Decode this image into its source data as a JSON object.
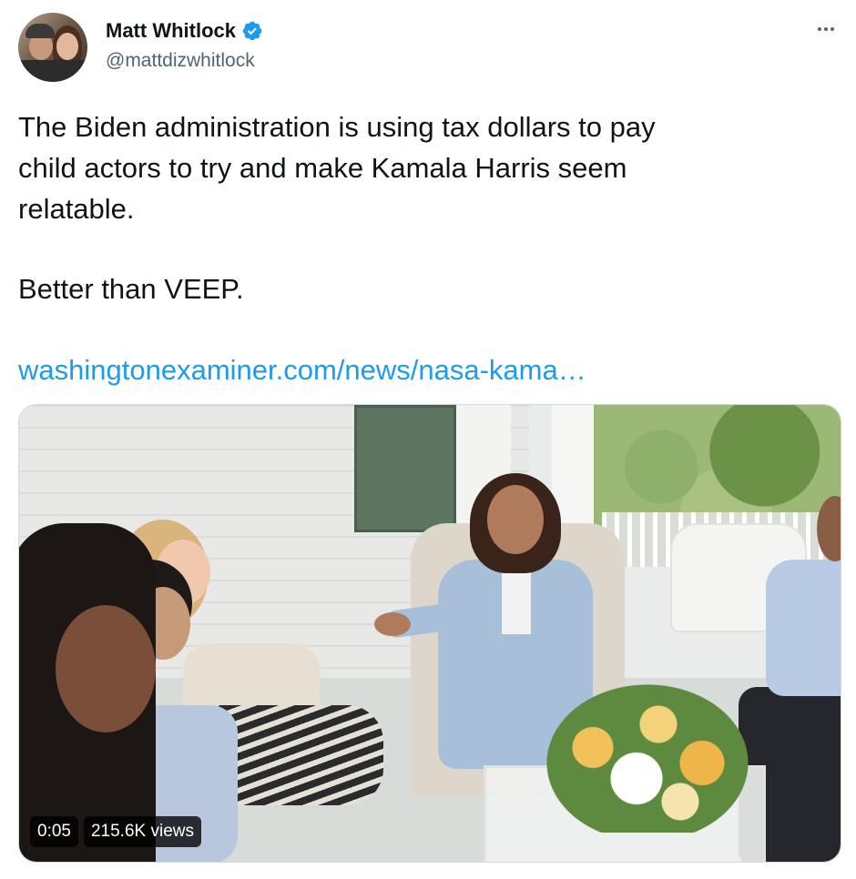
{
  "author": {
    "display_name": "Matt Whitlock",
    "handle": "@mattdizwhitlock",
    "verified": true
  },
  "tweet": {
    "text_lines": [
      "The Biden administration is using tax dollars to pay",
      "child actors to try and make Kamala Harris seem",
      "relatable."
    ],
    "text_para2": "Better than VEEP.",
    "link": "washingtonexaminer.com/news/nasa-kama…"
  },
  "media": {
    "timestamp": "0:05",
    "views": "215.6K views"
  },
  "colors": {
    "link": "#1d9bf0",
    "verified": "#1d9bf0",
    "secondary_text": "#536471",
    "primary_text": "#0f1419"
  },
  "icons": {
    "verified": "verified-badge-icon",
    "more": "more-horizontal-icon"
  }
}
